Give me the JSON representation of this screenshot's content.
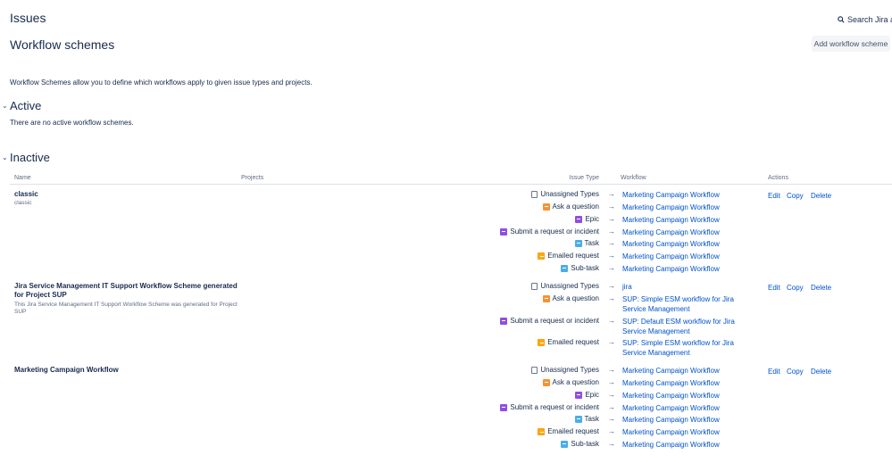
{
  "header": {
    "section": "Issues",
    "search_label": "Search Jira adm"
  },
  "page": {
    "title": "Workflow schemes",
    "add_button": "Add workflow scheme",
    "description": "Workflow Schemes allow you to define which workflows apply to given issue types and projects."
  },
  "active": {
    "heading": "Active",
    "empty_text": "There are no active workflow schemes."
  },
  "inactive": {
    "heading": "Inactive",
    "columns": {
      "name": "Name",
      "projects": "Projects",
      "issue_type": "Issue Type",
      "workflow": "Workflow",
      "actions": "Actions"
    },
    "arrow": "→",
    "actions": {
      "edit": "Edit",
      "copy": "Copy",
      "delete": "Delete"
    },
    "schemes": [
      {
        "name": "classic",
        "description": "classic",
        "mappings": [
          {
            "type": "Unassigned Types",
            "icon": "unassigned-icon",
            "workflow": "Marketing Campaign Workflow"
          },
          {
            "type": "Ask a question",
            "icon": "question-icon",
            "workflow": "Marketing Campaign Workflow"
          },
          {
            "type": "Epic",
            "icon": "epic-icon",
            "workflow": "Marketing Campaign Workflow"
          },
          {
            "type": "Submit a request or incident",
            "icon": "request-icon",
            "workflow": "Marketing Campaign Workflow"
          },
          {
            "type": "Task",
            "icon": "task-icon",
            "workflow": "Marketing Campaign Workflow"
          },
          {
            "type": "Emailed request",
            "icon": "email-icon",
            "workflow": "Marketing Campaign Workflow"
          },
          {
            "type": "Sub-task",
            "icon": "subtask-icon",
            "workflow": "Marketing Campaign Workflow"
          }
        ]
      },
      {
        "name": "Jira Service Management IT Support Workflow Scheme generated for Project SUP",
        "description": "This Jira Service Management IT Support Workflow Scheme was generated for Project SUP",
        "mappings": [
          {
            "type": "Unassigned Types",
            "icon": "unassigned-icon",
            "workflow": "jira"
          },
          {
            "type": "Ask a question",
            "icon": "question-icon",
            "workflow": "SUP: Simple ESM workflow for Jira Service Management"
          },
          {
            "type": "Submit a request or incident",
            "icon": "request-icon",
            "workflow": "SUP: Default ESM workflow for Jira Service Management"
          },
          {
            "type": "Emailed request",
            "icon": "email-icon",
            "workflow": "SUP: Simple ESM workflow for Jira Service Management"
          }
        ]
      },
      {
        "name": "Marketing Campaign Workflow",
        "description": "",
        "mappings": [
          {
            "type": "Unassigned Types",
            "icon": "unassigned-icon",
            "workflow": "Marketing Campaign Workflow"
          },
          {
            "type": "Ask a question",
            "icon": "question-icon",
            "workflow": "Marketing Campaign Workflow"
          },
          {
            "type": "Epic",
            "icon": "epic-icon",
            "workflow": "Marketing Campaign Workflow"
          },
          {
            "type": "Submit a request or incident",
            "icon": "request-icon",
            "workflow": "Marketing Campaign Workflow"
          },
          {
            "type": "Task",
            "icon": "task-icon",
            "workflow": "Marketing Campaign Workflow"
          },
          {
            "type": "Emailed request",
            "icon": "email-icon",
            "workflow": "Marketing Campaign Workflow"
          },
          {
            "type": "Sub-task",
            "icon": "subtask-icon",
            "workflow": "Marketing Campaign Workflow"
          }
        ]
      }
    ]
  },
  "colors": {
    "link": "#0052cc",
    "text": "#172b4d",
    "muted": "#5e6c84",
    "button_bg": "#f4f5f7"
  }
}
